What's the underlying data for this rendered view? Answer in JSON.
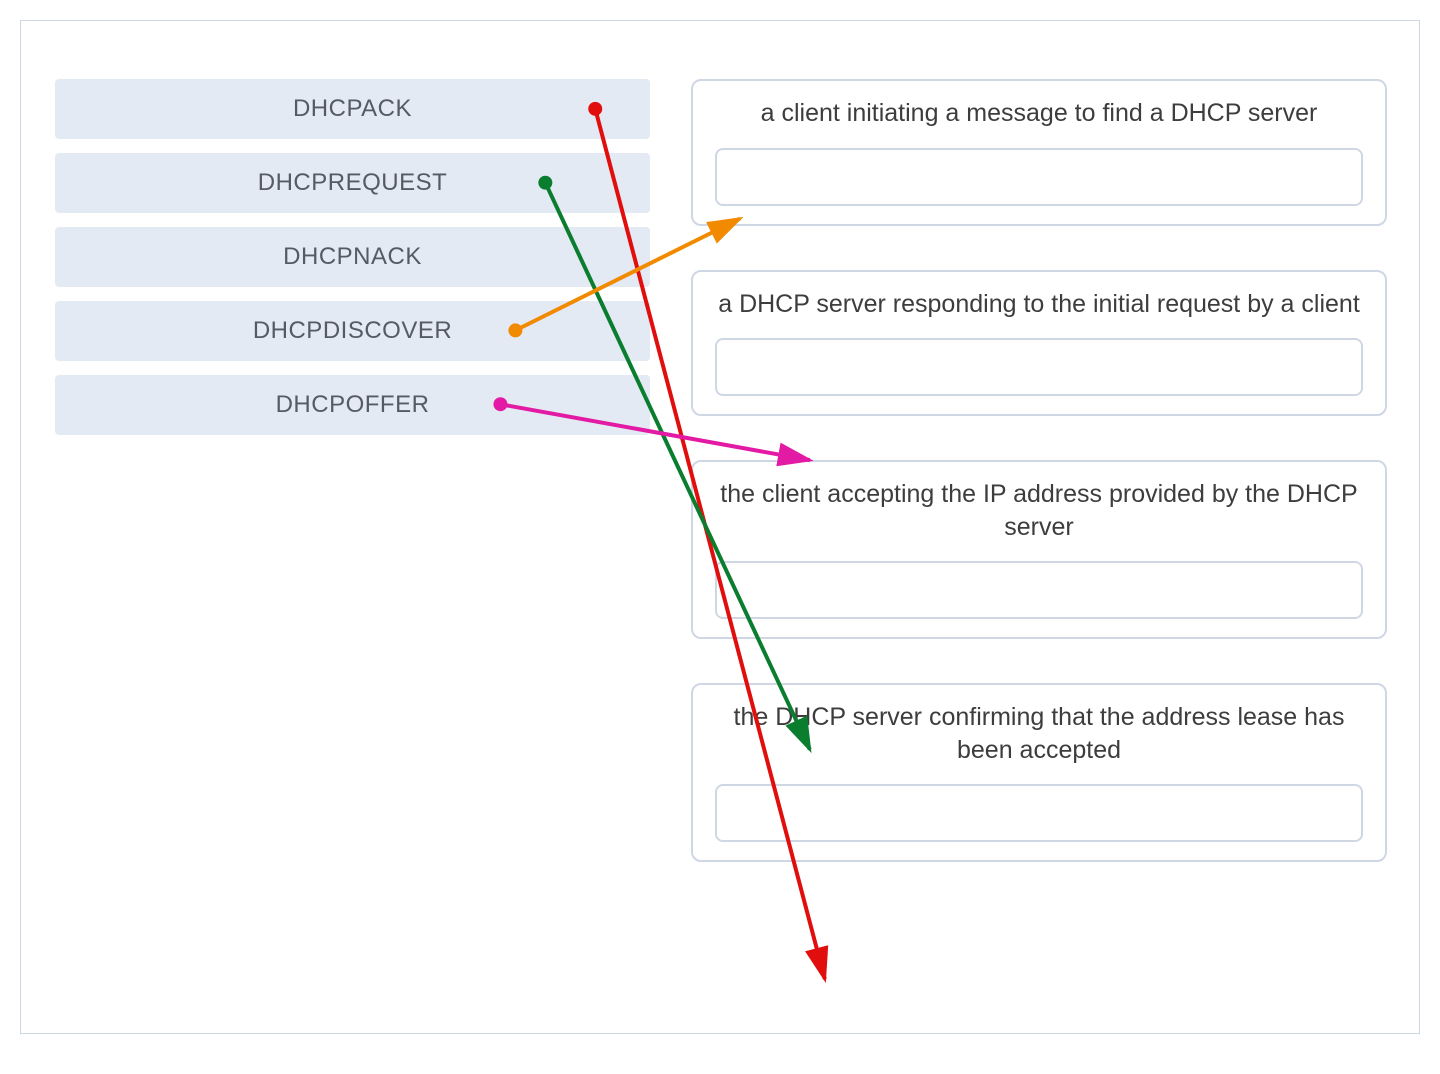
{
  "left_items": [
    {
      "label": "DHCPACK"
    },
    {
      "label": "DHCPREQUEST"
    },
    {
      "label": "DHCPNACK"
    },
    {
      "label": "DHCPDISCOVER"
    },
    {
      "label": "DHCPOFFER"
    }
  ],
  "right_cards": [
    {
      "desc": "a client initiating a message to find a DHCP server"
    },
    {
      "desc": "a DHCP server responding to the initial request by a client"
    },
    {
      "desc": "the client accepting the IP address provided by the DHCP server"
    },
    {
      "desc": "the DHCP server confirming that the address lease has been accepted"
    }
  ],
  "connections": [
    {
      "from": "DHCPACK",
      "to_index": 3,
      "color": "#e10e0e"
    },
    {
      "from": "DHCPREQUEST",
      "to_index": 2,
      "color": "#0a7d2f"
    },
    {
      "from": "DHCPDISCOVER",
      "to_index": 0,
      "color": "#f28a00"
    },
    {
      "from": "DHCPOFFER",
      "to_index": 1,
      "color": "#e31aa3"
    }
  ],
  "colors": {
    "panel_bg": "#e4eaf4",
    "border": "#cfd7e5"
  }
}
